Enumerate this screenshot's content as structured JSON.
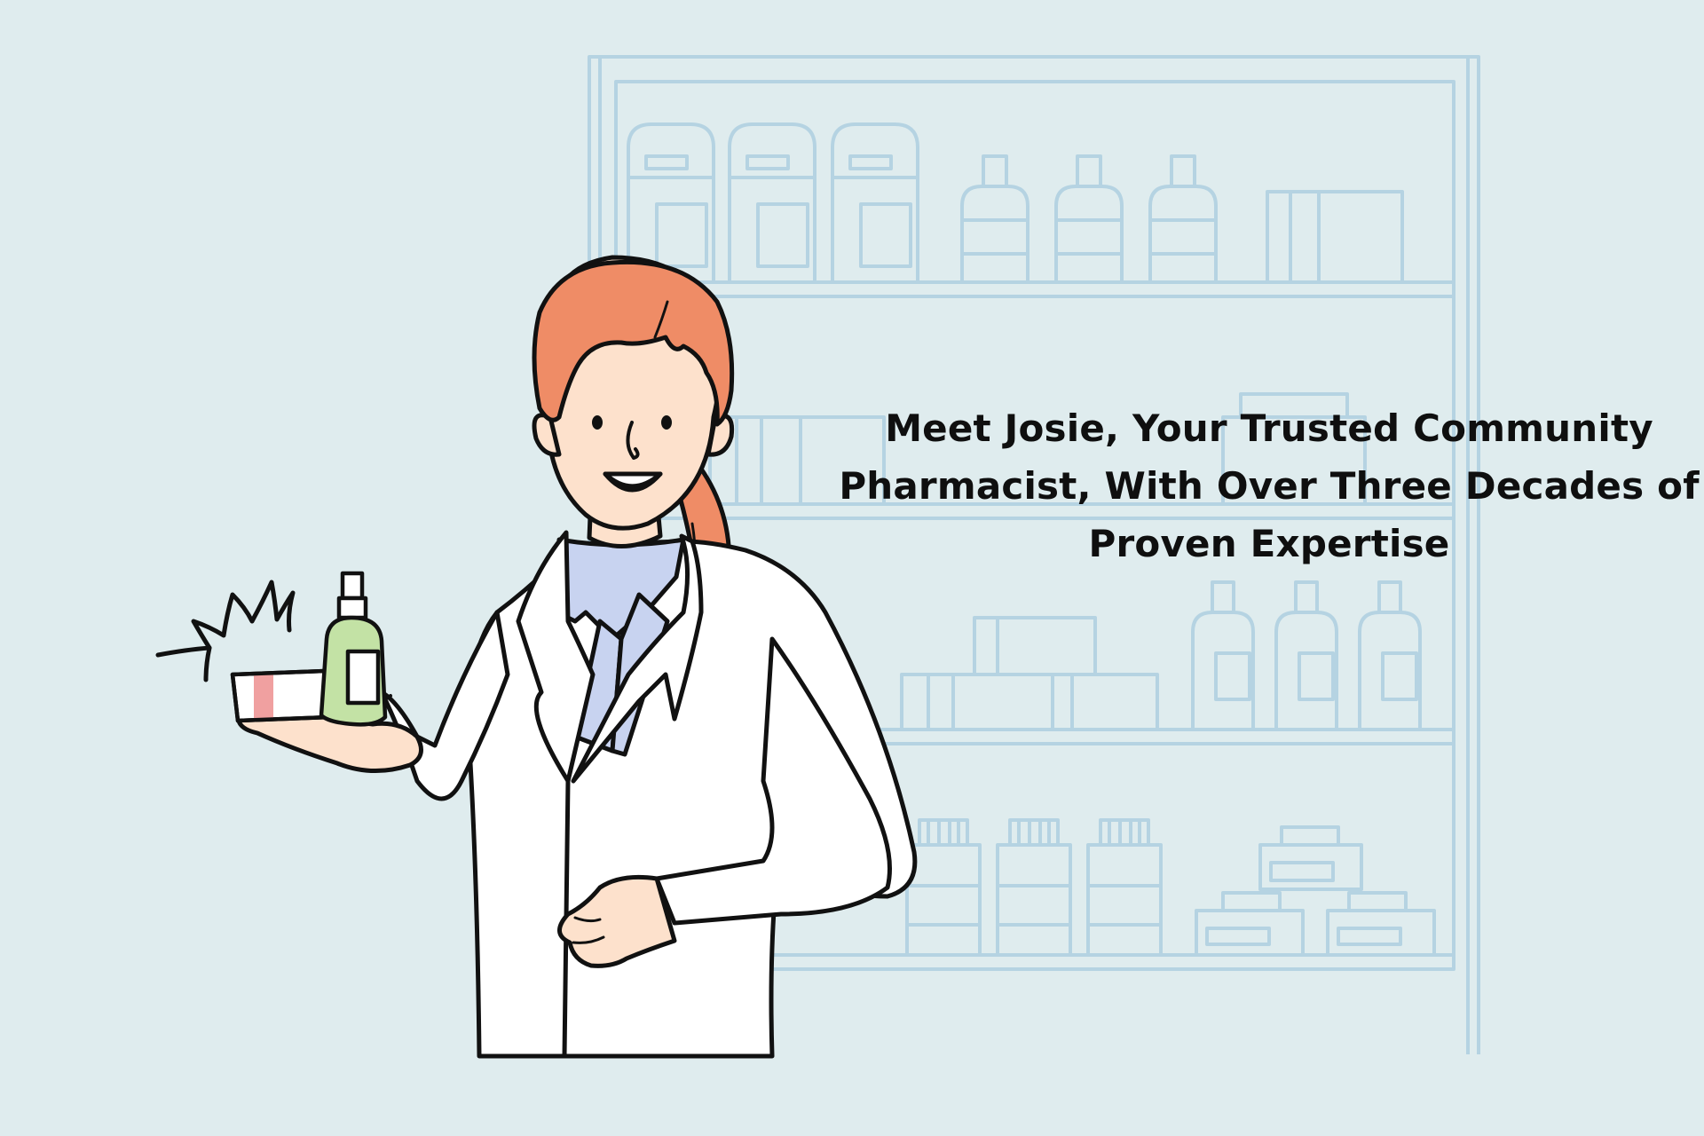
{
  "headline": {
    "line1": "Meet Josie, Your Trusted Community",
    "line2": "Pharmacist, With Over Three Decades of",
    "line3": "Proven Expertise"
  },
  "colors": {
    "background": "#dfecee",
    "shelf_outline": "#b5d3e2",
    "hair": "#ef8c66",
    "skin": "#fde1cc",
    "coat": "#ffffff",
    "shirt": "#c8d3f0",
    "bottle": "#c3e2a5",
    "outline": "#111111"
  },
  "icons": [
    "pharmacy-shelf-illustration",
    "pharmacist-illustration",
    "spray-bottle-icon",
    "ointment-box-icon",
    "sparkle-burst-icon"
  ]
}
